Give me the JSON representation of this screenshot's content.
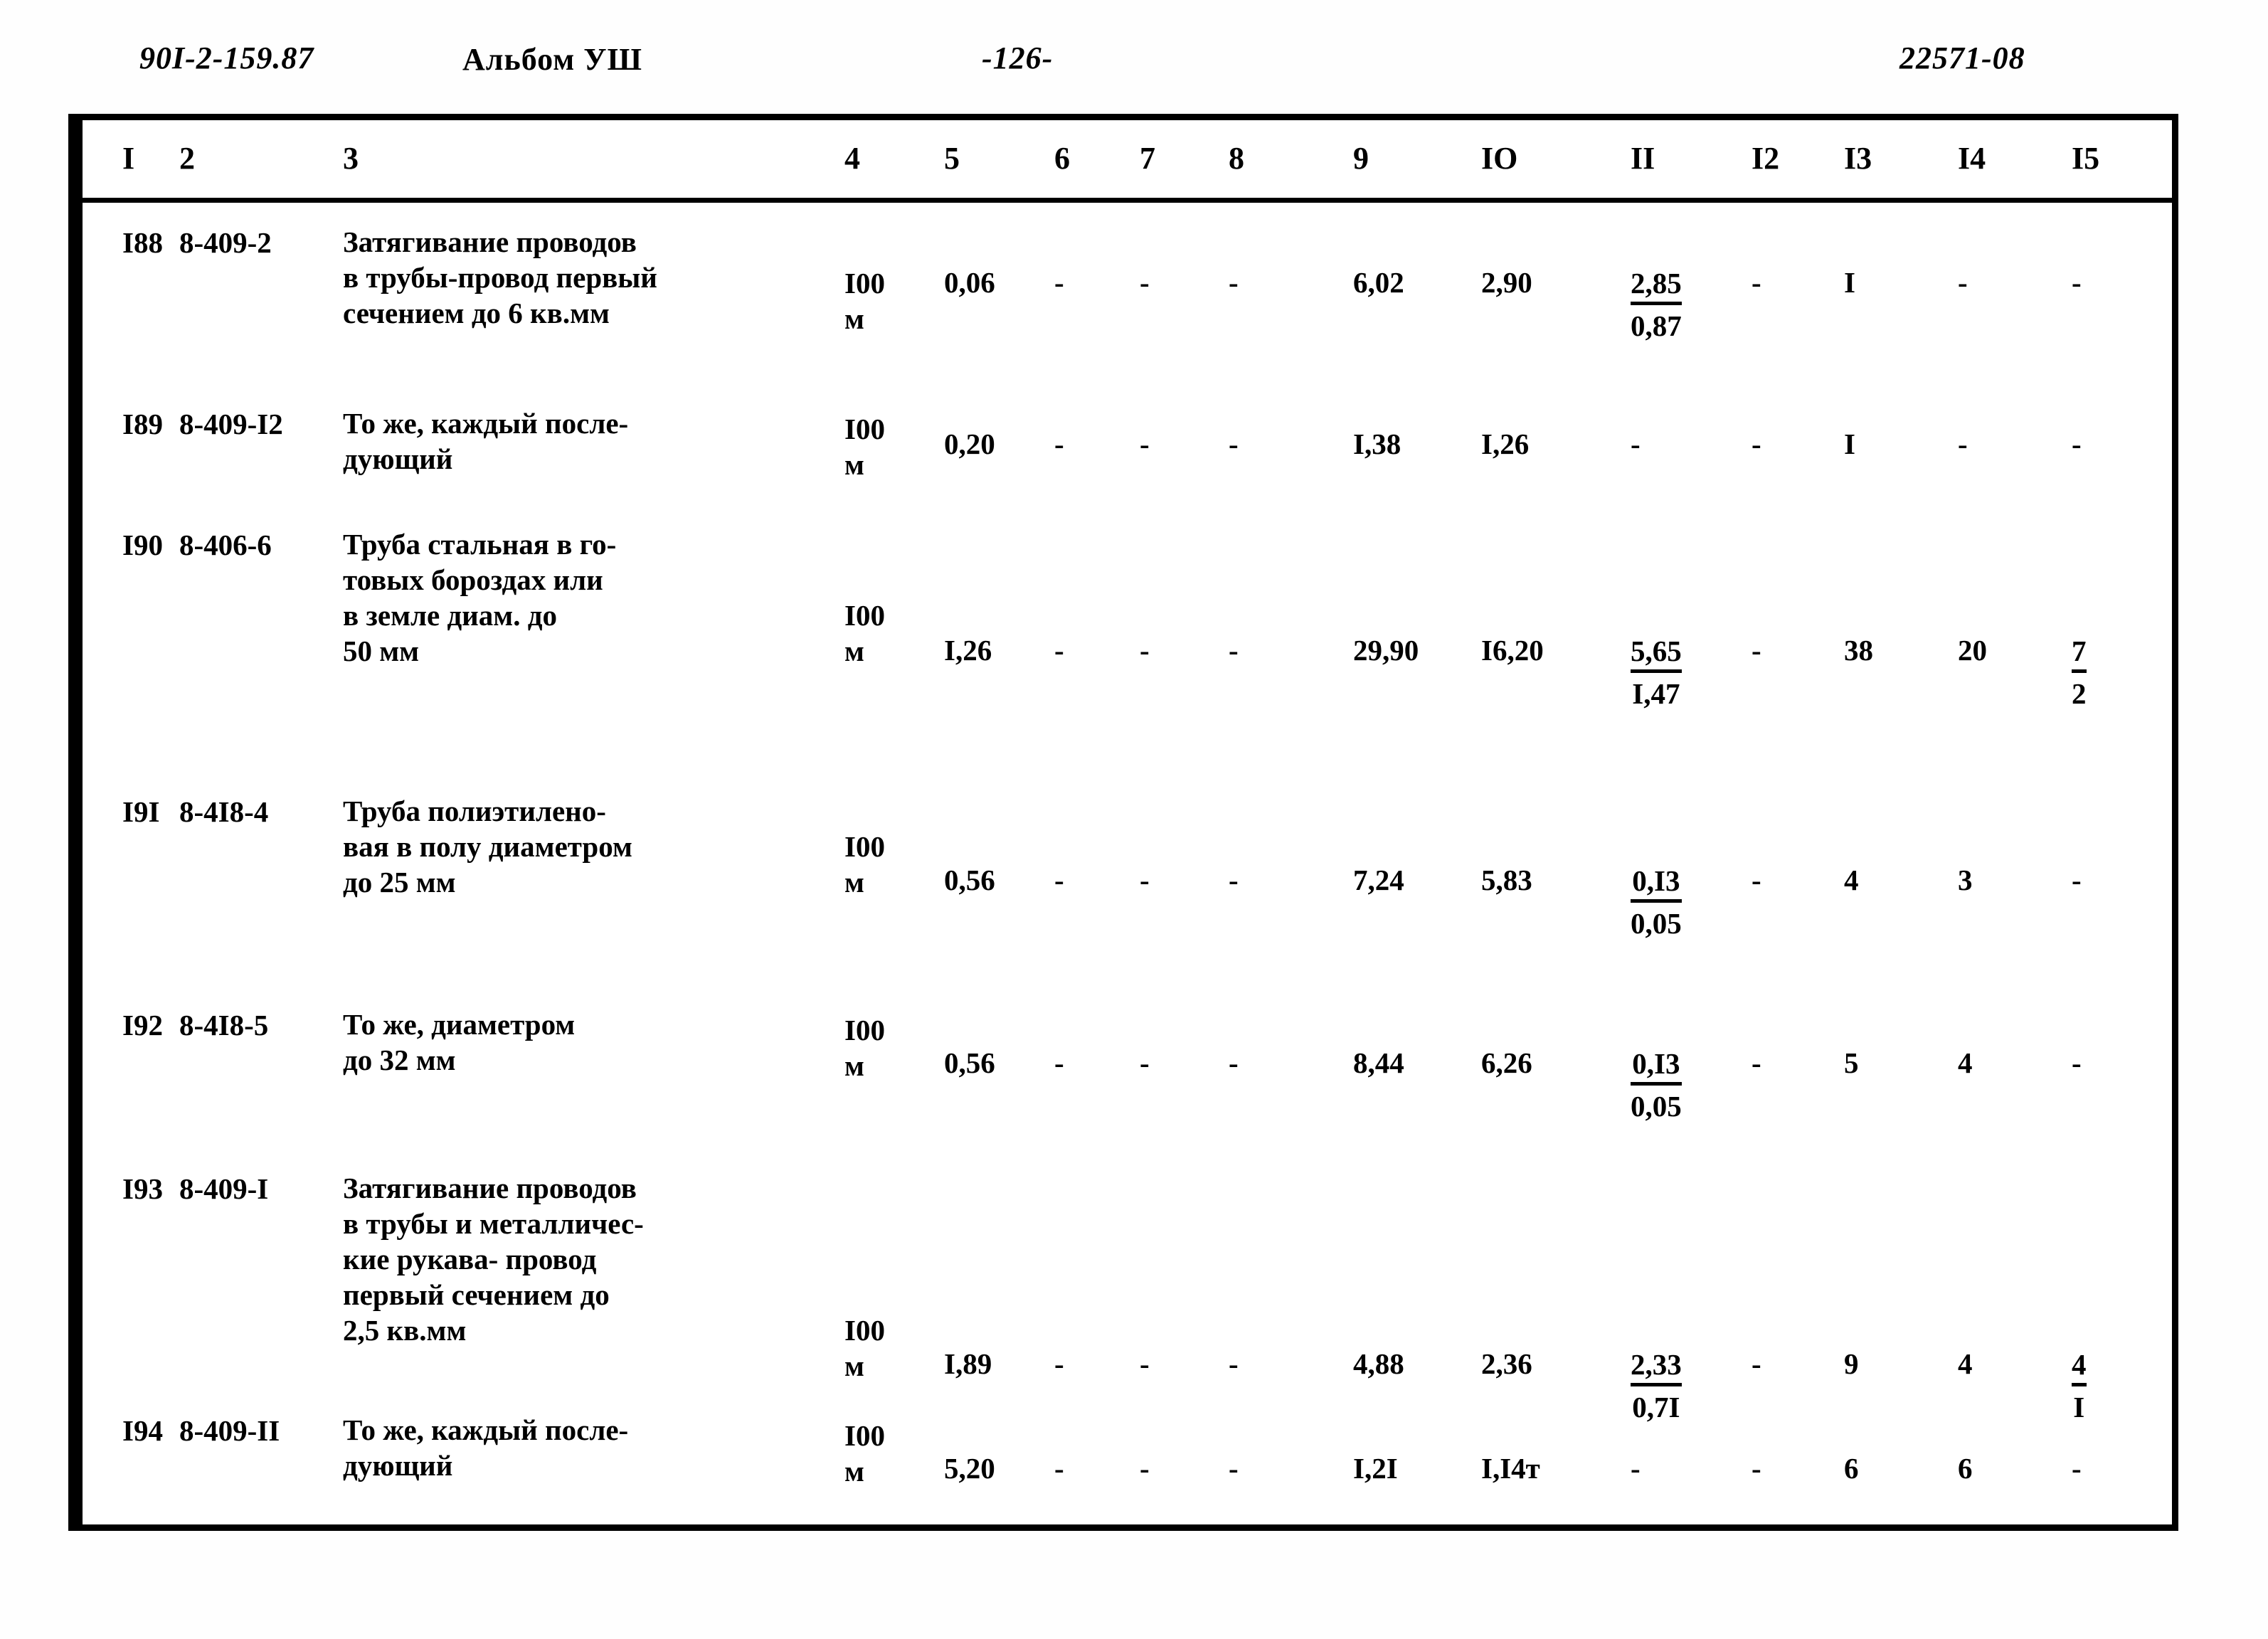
{
  "header": {
    "code": "90I-2-159.87",
    "album": "Альбом УШ",
    "page_number": "-126-",
    "doc_number": "22571-08"
  },
  "table": {
    "column_headers": [
      "I",
      "2",
      "3",
      "4",
      "5",
      "6",
      "7",
      "8",
      "9",
      "IO",
      "II",
      "I2",
      "I3",
      "I4",
      "I5"
    ],
    "rows": [
      {
        "num": "I88",
        "code": "8-409-2",
        "description": "Затягивание проводов\nв трубы-провод первый\nсечением до 6 кв.мм",
        "unit": "I00\nм",
        "c5": "0,06",
        "c6": "-",
        "c7": "-",
        "c8": "-",
        "c9": "6,02",
        "c10": "2,90",
        "c11_top": "2,85",
        "c11_bot": "0,87",
        "c12": "-",
        "c13": "I",
        "c14": "-",
        "c15": "-"
      },
      {
        "num": "I89",
        "code": "8-409-I2",
        "description": "То же, каждый после-\nдующий",
        "unit": "I00\nм",
        "c5": "0,20",
        "c6": "-",
        "c7": "-",
        "c8": "-",
        "c9": "I,38",
        "c10": "I,26",
        "c11_top": "-",
        "c11_bot": "",
        "c12": "-",
        "c13": "I",
        "c14": "-",
        "c15": "-"
      },
      {
        "num": "I90",
        "code": "8-406-6",
        "description": "Труба стальная в го-\nтовых бороздах или\nв земле диам. до\n50 мм",
        "unit": "I00\nм",
        "c5": "I,26",
        "c6": "-",
        "c7": "-",
        "c8": "-",
        "c9": "29,90",
        "c10": "I6,20",
        "c11_top": "5,65",
        "c11_bot": "I,47",
        "c12": "-",
        "c13": "38",
        "c14": "20",
        "c15_top": "7",
        "c15_bot": "2"
      },
      {
        "num": "I9I",
        "code": "8-4I8-4",
        "description": "Труба полиэтилено-\nвая в полу диаметром\nдо 25 мм",
        "unit": "I00\nм",
        "c5": "0,56",
        "c6": "-",
        "c7": "-",
        "c8": "-",
        "c9": "7,24",
        "c10": "5,83",
        "c11_top": "0,I3",
        "c11_bot": "0,05",
        "c12": "-",
        "c13": "4",
        "c14": "3",
        "c15": "-"
      },
      {
        "num": "I92",
        "code": "8-4I8-5",
        "description": "То же, диаметром\nдо 32 мм",
        "unit": "I00\nм",
        "c5": "0,56",
        "c6": "-",
        "c7": "-",
        "c8": "-",
        "c9": "8,44",
        "c10": "6,26",
        "c11_top": "0,I3",
        "c11_bot": "0,05",
        "c12": "-",
        "c13": "5",
        "c14": "4",
        "c15": "-"
      },
      {
        "num": "I93",
        "code": "8-409-I",
        "description": "Затягивание проводов\nв трубы и металличес-\nкие рукава- провод\nпервый сечением до\n2,5 кв.мм",
        "unit": "I00\nм",
        "c5": "I,89",
        "c6": "-",
        "c7": "-",
        "c8": "-",
        "c9": "4,88",
        "c10": "2,36",
        "c11_top": "2,33",
        "c11_bot": "0,7I",
        "c12": "-",
        "c13": "9",
        "c14": "4",
        "c15_top": "4",
        "c15_bot": "I"
      },
      {
        "num": "I94",
        "code": "8-409-II",
        "description": "То же, каждый после-\nдующий",
        "unit": "I00\nм",
        "c5": "5,20",
        "c6": "-",
        "c7": "-",
        "c8": "-",
        "c9": "I,2I",
        "c10": "I,I4т",
        "c11_top": "-",
        "c11_bot": "",
        "c12": "-",
        "c13": "6",
        "c14": "6",
        "c15": "-"
      }
    ]
  }
}
